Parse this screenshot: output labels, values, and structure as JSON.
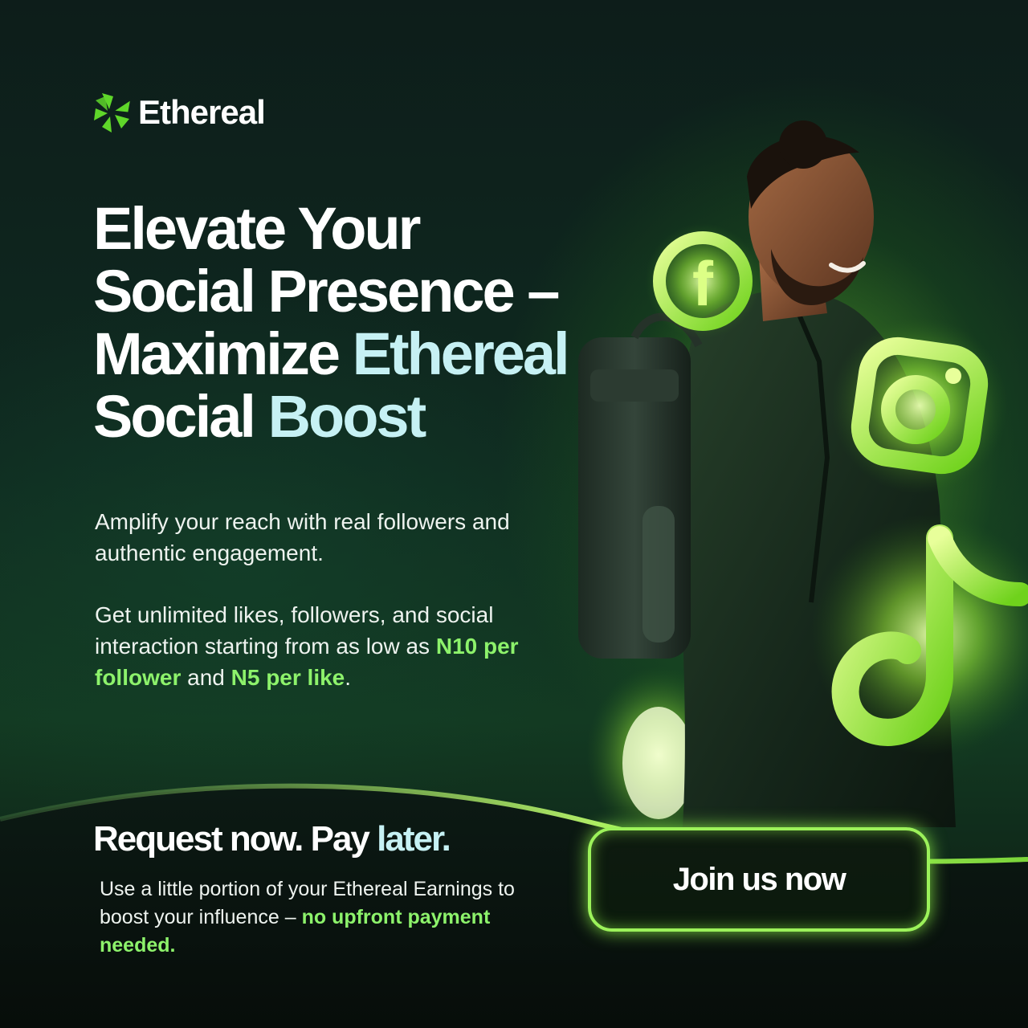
{
  "brand": {
    "name": "Ethereal",
    "logo_icon": "ethereal-pinwheel-icon",
    "accent_color": "#7bdc2e"
  },
  "headline": {
    "line1": "Elevate Your",
    "line2": "Social Presence –",
    "line3_part1": "Maximize ",
    "line3_part2": "Ethereal",
    "line4_part1": "Social ",
    "line4_part2": "Boost"
  },
  "intro": {
    "text": "Amplify your reach with real followers and authentic engagement."
  },
  "pricing": {
    "text_before": "Get unlimited likes, followers, and social interaction starting from as low as ",
    "follower_price": "N10 per follower",
    "text_middle": " and ",
    "like_price": "N5 per like",
    "text_after": "."
  },
  "offer": {
    "title_part1": "Request now. Pay ",
    "title_part2": "later.",
    "text_before": "Use a little portion of your Ethereal Earnings to boost your influence – ",
    "text_highlight": "no upfront payment needed."
  },
  "cta": {
    "label": "Join us now"
  },
  "icons": [
    "facebook-icon",
    "instagram-icon",
    "tiktok-icon"
  ],
  "colors": {
    "highlight": "#8df26b",
    "heading_accent": "#c6f1f4",
    "background": "#0d1d1a"
  }
}
